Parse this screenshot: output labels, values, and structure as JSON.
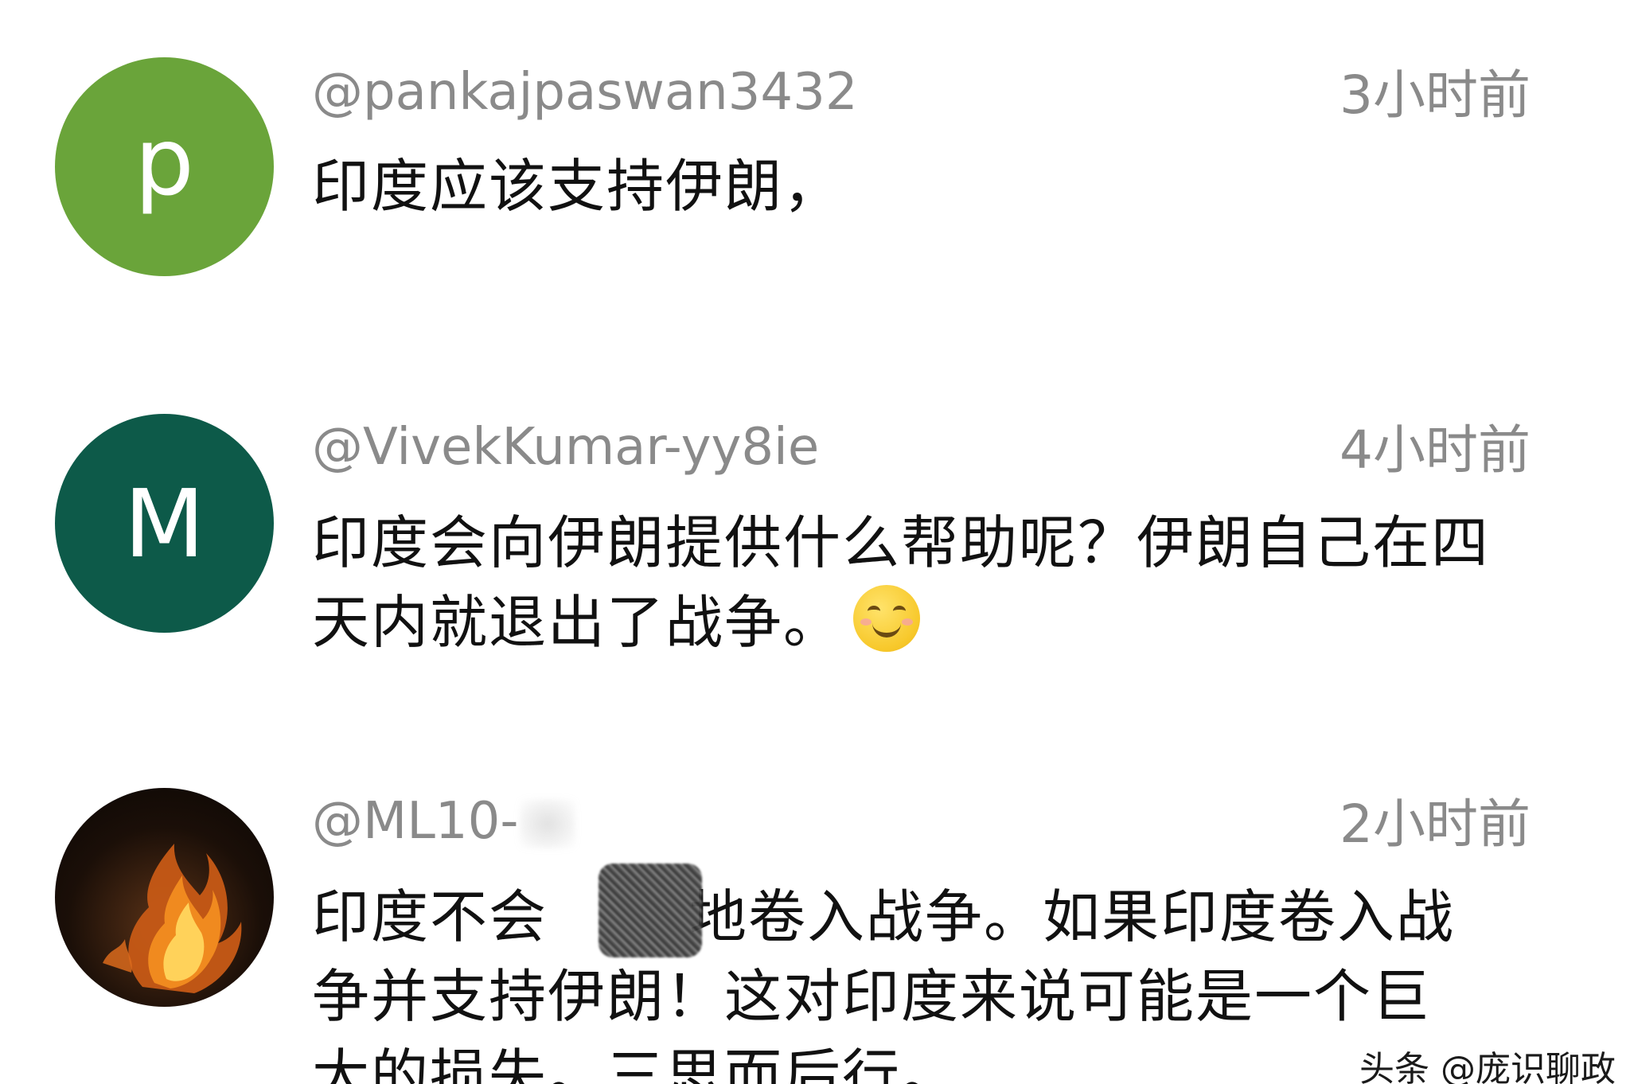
{
  "comments": [
    {
      "username": "@pankajpaswan3432",
      "time": "3小时前",
      "avatar_letter": "p",
      "avatar_color": "#6aa43a",
      "text": "印度应该支持伊朗，"
    },
    {
      "username": "@VivekKumar-yy8ie",
      "time": "4小时前",
      "avatar_letter": "M",
      "avatar_color": "#0d5a49",
      "text": "印度会向伊朗提供什么帮助呢？伊朗自己在四天内就退出了战争。",
      "emoji": "smiling-face-with-smiling-eyes"
    },
    {
      "username": "@ML10-",
      "time": "2小时前",
      "avatar_image": "fire-photo",
      "text_lines": [
        "印度不会",
        "地卷入战争。如果印度卷入战",
        "争并支持伊朗！这对印度来说可能是一个巨",
        "大的损失。三思而后行。"
      ]
    }
  ],
  "watermark": "头条 @庞识聊政"
}
